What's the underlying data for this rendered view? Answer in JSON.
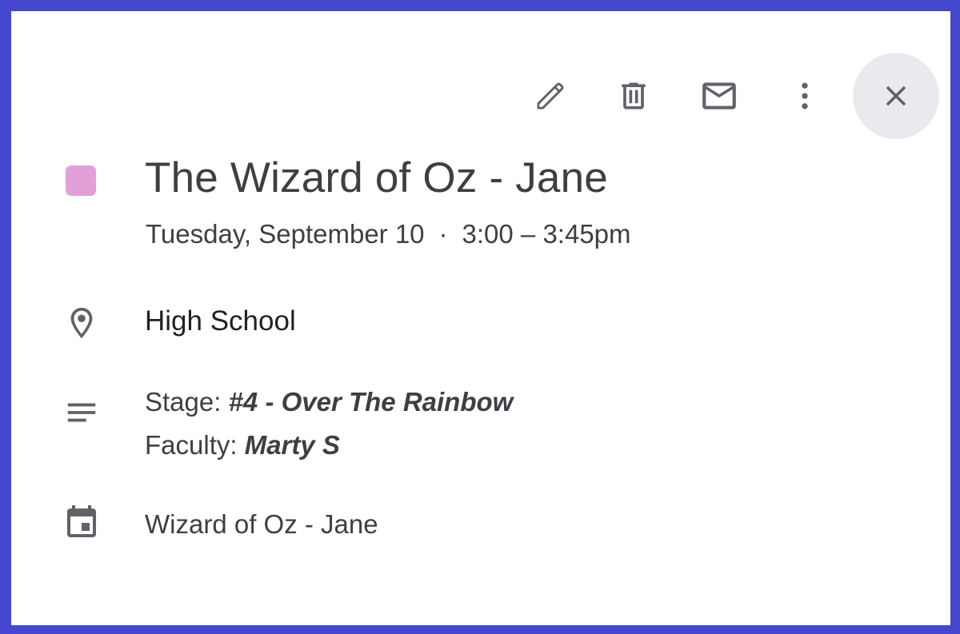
{
  "toolbar": {
    "edit_icon": "pencil-icon",
    "delete_icon": "trash-icon",
    "email_icon": "envelope-icon",
    "more_icon": "more-vert-icon",
    "close_icon": "close-icon"
  },
  "event": {
    "color": "#e39fd7",
    "title": "The Wizard of Oz - Jane",
    "date": "Tuesday, September 10",
    "separator": "·",
    "time": "3:00 – 3:45pm",
    "location": "High School",
    "description": {
      "line1_label": "Stage: ",
      "line1_value": "#4 - Over The Rainbow",
      "line2_label": "Faculty: ",
      "line2_value": "Marty S"
    },
    "calendar": "Wizard of Oz - Jane"
  }
}
